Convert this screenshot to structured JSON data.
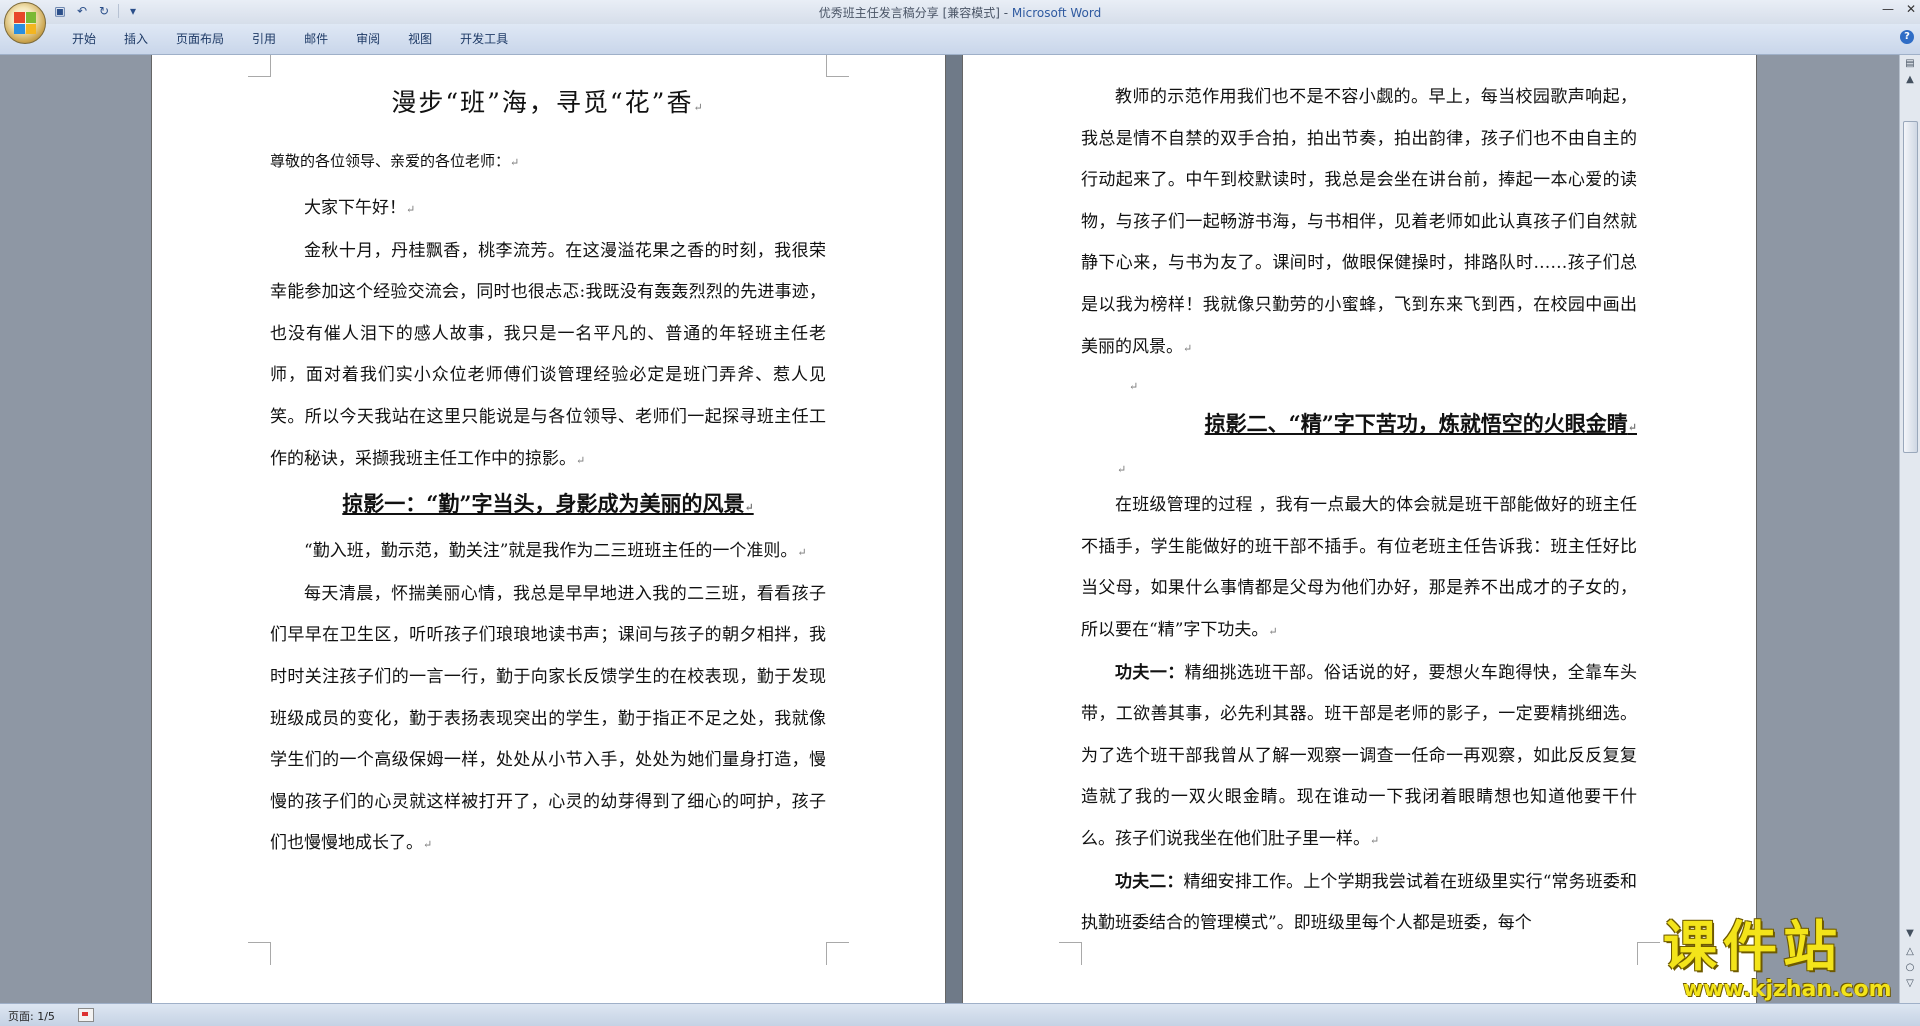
{
  "window": {
    "title": "优秀班主任发言稿分享 [兼容模式] - ",
    "app_name": "Microsoft Word"
  },
  "quick_access": {
    "save_icon": "save-icon",
    "undo_icon": "undo-icon",
    "redo_icon": "redo-icon",
    "customize_icon": "dropdown-icon"
  },
  "ribbon": {
    "tabs": [
      "开始",
      "插入",
      "页面布局",
      "引用",
      "邮件",
      "审阅",
      "视图",
      "开发工具"
    ]
  },
  "page1": {
    "title": "漫步“班”海，寻觅“花”香",
    "salutation": "尊敬的各位领导、亲爱的各位老师：",
    "greeting": "大家下午好！",
    "intro": "金秋十月，丹桂飘香，桃李流芳。在这漫溢花果之香的时刻，我很荣幸能参加这个经验交流会，同时也很忐忑:我既没有轰轰烈烈的先进事迹，也没有催人泪下的感人故事，我只是一名平凡的、普通的年轻班主任老师，面对着我们实小众位老师傅们谈管理经验必定是班门弄斧、惹人见笑。所以今天我站在这里只能说是与各位领导、老师们一起探寻班主任工作的秘诀，采撷我班主任工作中的掠影。",
    "heading1": "掠影一：“勤”字当头，身影成为美丽的风景",
    "para1": "“勤入班，勤示范，勤关注”就是我作为二三班班主任的一个准则。",
    "para2": "每天清晨，怀揣美丽心情，我总是早早地进入我的二三班，看看孩子们早早在卫生区，听听孩子们琅琅地读书声；课间与孩子的朝夕相拌，我时时关注孩子们的一言一行，勤于向家长反馈学生的在校表现，勤于发现班级成员的变化，勤于表扬表现突出的学生，勤于指正不足之处，我就像学生们的一个高级保姆一样，处处从小节入手，处处为她们量身打造，慢慢的孩子们的心灵就这样被打开了，心灵的幼芽得到了细心的呵护，孩子们也慢慢地成长了。"
  },
  "page2": {
    "para1": "教师的示范作用我们也不是不容小觑的。早上，每当校园歌声响起，我总是情不自禁的双手合拍，拍出节奏，拍出韵律，孩子们也不由自主的行动起来了。中午到校默读时，我总是会坐在讲台前，捧起一本心爱的读物，与孩子们一起畅游书海，与书相伴，见着老师如此认真孩子们自然就静下心来，与书为友了。课间时，做眼保健操时，排路队时……孩子们总是以我为榜样！我就像只勤劳的小蜜蜂，飞到东来飞到西，在校园中画出美丽的风景。",
    "heading2": "掠影二、“精”字下苦功，炼就悟空的火眼金睛",
    "para2": "在班级管理的过程 ，我有一点最大的体会就是班干部能做好的班主任不插手，学生能做好的班干部不插手。有位老班主任告诉我：班主任好比当父母，如果什么事情都是父母为他们办好，那是养不出成才的子女的，所以要在“精”字下功夫。",
    "kf1_lead": "功夫一：",
    "kf1_text": "精细挑选班干部。俗话说的好，要想火车跑得快，全靠车头带，工欲善其事，必先利其器。班干部是老师的影子，一定要精挑细选。为了选个班干部我曾从了解一观察一调查一任命一再观察，如此反反复复造就了我的一双火眼金睛。现在谁动一下我闭着眼睛想也知道他要干什么。孩子们说我坐在他们肚子里一样。",
    "kf2_lead": "功夫二：",
    "kf2_text": "精细安排工作。上个学期我尝试着在班级里实行“常务班委和执勤班委结合的管理模式”。即班级里每个人都是班委，每个"
  },
  "paragraph_mark": "↵",
  "status": {
    "page": "页面: 1/5"
  },
  "watermark": {
    "main": "课件站",
    "sub": "www.kjzhan.com"
  }
}
